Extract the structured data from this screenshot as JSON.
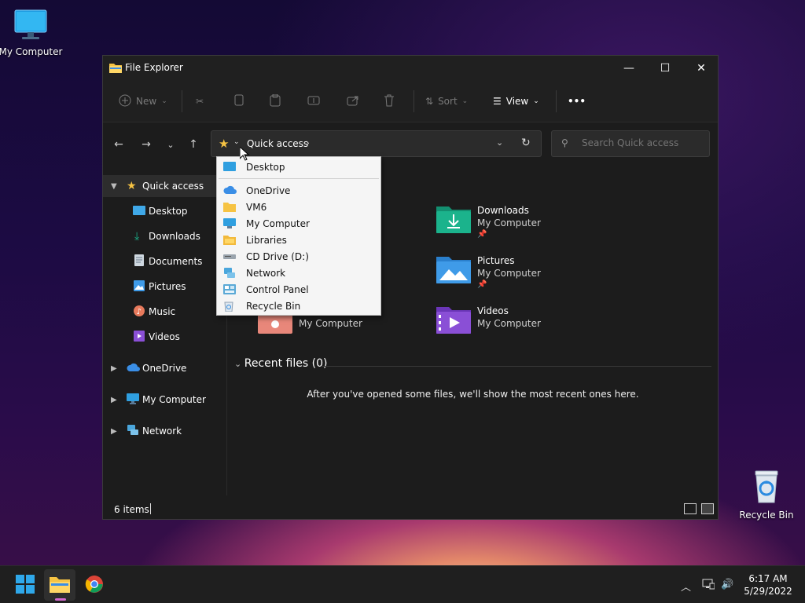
{
  "desktop": {
    "my_computer_label": "My Computer",
    "recycle_bin_label": "Recycle Bin"
  },
  "window": {
    "title": "File Explorer",
    "controls": {
      "minimize": "—",
      "maximize": "☐",
      "close": "✕"
    }
  },
  "commandbar": {
    "new_label": "New",
    "sort_label": "Sort",
    "view_label": "View",
    "more_label": "•••"
  },
  "address": {
    "crumb": "Quick access",
    "search_placeholder": "Search Quick access"
  },
  "sidebar": {
    "items": [
      {
        "label": "Quick access"
      },
      {
        "label": "Desktop"
      },
      {
        "label": "Downloads"
      },
      {
        "label": "Documents"
      },
      {
        "label": "Pictures"
      },
      {
        "label": "Music"
      },
      {
        "label": "Videos"
      },
      {
        "label": "OneDrive"
      },
      {
        "label": "My Computer"
      },
      {
        "label": "Network"
      }
    ]
  },
  "content": {
    "tiles": [
      {
        "name": "Downloads",
        "location": "My Computer"
      },
      {
        "name": "Pictures",
        "location": "My Computer"
      },
      {
        "name": "Videos",
        "location": "My Computer"
      },
      {
        "name": "",
        "location": "My Computer"
      }
    ],
    "recent_header": "Recent files (0)",
    "recent_message": "After you've opened some files, we'll show the most recent ones here."
  },
  "dropdown": {
    "items": [
      {
        "label": "Desktop"
      },
      {
        "label": "OneDrive"
      },
      {
        "label": "VM6"
      },
      {
        "label": "My Computer"
      },
      {
        "label": "Libraries"
      },
      {
        "label": "CD Drive (D:)"
      },
      {
        "label": "Network"
      },
      {
        "label": "Control Panel"
      },
      {
        "label": "Recycle Bin"
      }
    ]
  },
  "status": {
    "items": "6 items"
  },
  "taskbar": {
    "time": "6:17 AM",
    "date": "5/29/2022"
  },
  "colors": {
    "accent_folder": "#f6c343",
    "onedrive": "#3a8ee6",
    "downloads_folder": "#1bb38c",
    "pictures_folder": "#3f9be8",
    "videos_folder": "#8a4fd6"
  }
}
